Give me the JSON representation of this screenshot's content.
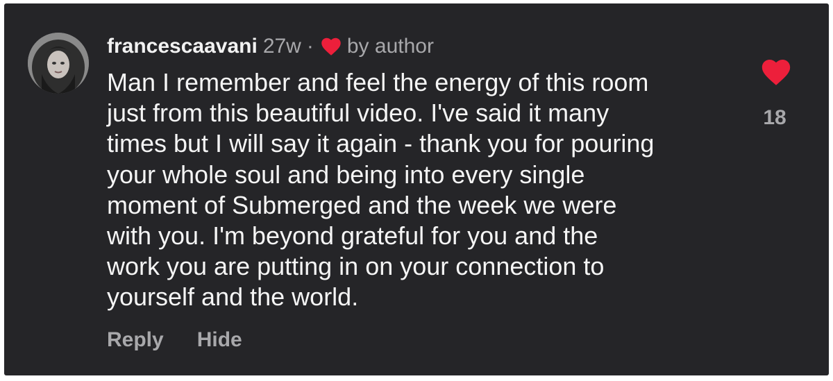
{
  "comment": {
    "username": "francescaavani",
    "time": "27w",
    "separator": "·",
    "liked_by": "by author",
    "body_lines": [
      "Man I remember and feel the energy of this room",
      "just from this beautiful video. I've said it many",
      "times but I will say it again - thank you for pouring",
      "your whole soul and being into every single",
      "moment of Submerged and the week we were",
      "with you. I'm beyond grateful for you and the",
      "work you are putting in on your connection to",
      "yourself and the world."
    ],
    "like_count": "18"
  },
  "actions": {
    "reply_label": "Reply",
    "hide_label": "Hide"
  },
  "icons": {
    "author_heart": "heart-icon",
    "like_heart": "heart-icon",
    "avatar": "profile-photo"
  },
  "colors": {
    "background": "#252528",
    "heart": "#ed1f3b",
    "muted_text": "#a8a8ab",
    "primary_text": "#f5f5f5"
  }
}
